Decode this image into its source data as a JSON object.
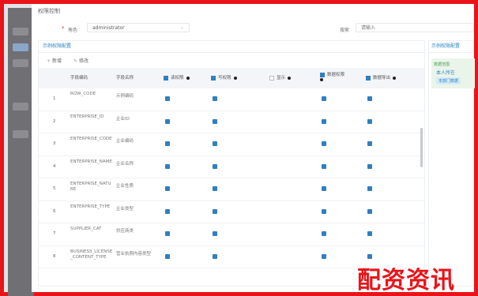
{
  "dialog": {
    "title": "权限控制"
  },
  "form": {
    "required_mark": "*",
    "field1_label": "角色",
    "field1_value": "administrator",
    "field2_label": "搜索",
    "field2_placeholder": "请输入"
  },
  "left_panel": {
    "title": "示例权限配置",
    "toolbar": {
      "add_label": "新增",
      "edit_label": "修改"
    },
    "columns": {
      "index": "",
      "code": "字段编码",
      "name": "字段名称",
      "c1": "读权限",
      "c2": "写权限",
      "c3": "显示",
      "c4": "数据权限",
      "c5": "数据导出"
    },
    "rows": [
      {
        "index": "1",
        "code": "ROW_CODE",
        "name": "示例编码",
        "c1": true,
        "c2": true,
        "c3": false,
        "c4": true,
        "c5": true
      },
      {
        "index": "2",
        "code": "ENTERPRISE_ID",
        "name": "企业ID",
        "c1": true,
        "c2": true,
        "c3": false,
        "c4": true,
        "c5": true
      },
      {
        "index": "3",
        "code": "ENTERPRISE_CODE",
        "name": "企业编码",
        "c1": true,
        "c2": true,
        "c3": false,
        "c4": true,
        "c5": true
      },
      {
        "index": "4",
        "code": "ENTERPRISE_NAME",
        "name": "企业名称",
        "c1": true,
        "c2": true,
        "c3": false,
        "c4": true,
        "c5": true
      },
      {
        "index": "5",
        "code": "ENTERPRISE_NATURE",
        "name": "企业性质",
        "c1": true,
        "c2": true,
        "c3": false,
        "c4": true,
        "c5": true
      },
      {
        "index": "6",
        "code": "ENTERPRISE_TYPE",
        "name": "企业类型",
        "c1": true,
        "c2": true,
        "c3": false,
        "c4": true,
        "c5": true
      },
      {
        "index": "7",
        "code": "SUPPLIER_CAT",
        "name": "供应商类",
        "c1": true,
        "c2": true,
        "c3": false,
        "c4": true,
        "c5": true
      },
      {
        "index": "8",
        "code": "BUSINESS_LICENSE_CONTENT_TYPE",
        "name": "营业执照内容类型",
        "c1": true,
        "c2": true,
        "c3": false,
        "c4": true,
        "c5": true
      }
    ]
  },
  "right_panel": {
    "title": "示例权限配置",
    "line1": "数据范围",
    "line2": "本人所在",
    "line3": "本部门数据"
  },
  "watermark": "配资资讯",
  "colors": {
    "frame": "#e8141a",
    "accent": "#2f7fc1",
    "panel_title": "#2b86c5"
  }
}
